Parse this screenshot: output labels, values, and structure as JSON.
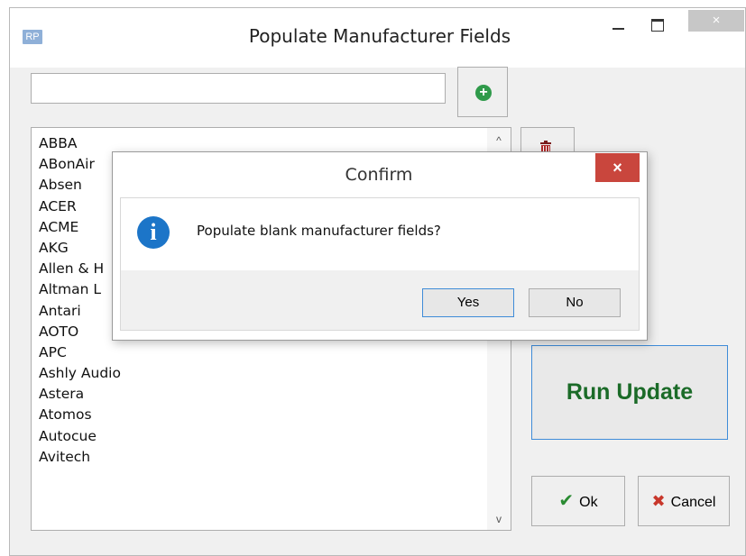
{
  "window": {
    "app_icon_text": "RP",
    "title": "Populate Manufacturer Fields",
    "close_glyph": "×"
  },
  "search": {
    "value": ""
  },
  "manufacturers": [
    "ABBA",
    "ABonAir",
    "Absen",
    "ACER",
    "ACME",
    "AKG",
    "Allen & H",
    "Altman L",
    "Antari",
    "AOTO",
    "APC",
    "Ashly Audio",
    "Astera",
    "Atomos",
    "Autocue",
    "Avitech"
  ],
  "buttons": {
    "run_update": "Run Update",
    "ok": "Ok",
    "cancel": "Cancel"
  },
  "confirm": {
    "title": "Confirm",
    "message": "Populate blank manufacturer fields?",
    "yes": "Yes",
    "no": "No",
    "close_glyph": "×"
  },
  "icons": {
    "add": "plus-circle-icon",
    "delete": "trash-icon",
    "ok": "check-icon",
    "cancel": "x-icon",
    "info": "info-icon"
  },
  "colors": {
    "run_update_text": "#1b6b28",
    "info": "#1c75c8",
    "dialog_close": "#c9463d",
    "accent_border": "#3f8cd8"
  }
}
